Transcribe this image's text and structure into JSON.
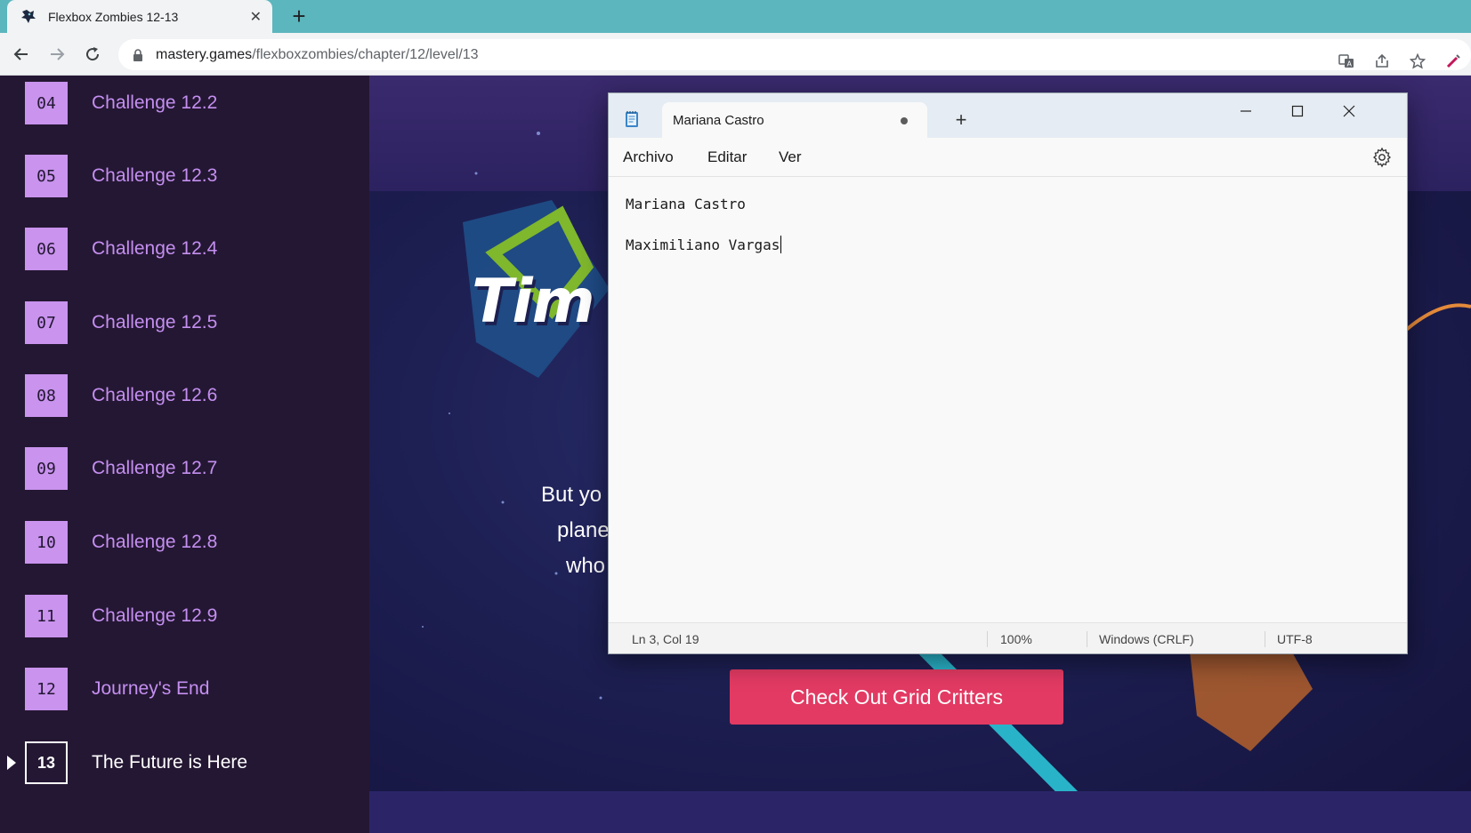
{
  "browser": {
    "tab_title": "Flexbox Zombies 12-13",
    "url_host": "mastery.games",
    "url_path": "/flexboxzombies/chapter/12/level/13",
    "icons": [
      "back-icon",
      "forward-icon",
      "reload-icon",
      "lock-icon",
      "translate-icon",
      "share-icon",
      "star-icon",
      "extension-icon"
    ]
  },
  "sidebar": {
    "levels": [
      {
        "num": "04",
        "name": "Challenge 12.2"
      },
      {
        "num": "05",
        "name": "Challenge 12.3"
      },
      {
        "num": "06",
        "name": "Challenge 12.4"
      },
      {
        "num": "07",
        "name": "Challenge 12.5"
      },
      {
        "num": "08",
        "name": "Challenge 12.6"
      },
      {
        "num": "09",
        "name": "Challenge 12.7"
      },
      {
        "num": "10",
        "name": "Challenge 12.8"
      },
      {
        "num": "11",
        "name": "Challenge 12.9"
      },
      {
        "num": "12",
        "name": "Journey's End"
      },
      {
        "num": "13",
        "name": "The Future is Here"
      }
    ],
    "current_index": 9,
    "accent": "#c993ee"
  },
  "hero": {
    "logo_partial": "Tim",
    "line1": "But yo",
    "line2": "plane",
    "line3": "who",
    "cta": "Check Out Grid Critters",
    "cta_color": "#e23a63"
  },
  "notepad": {
    "tab_title": "Mariana Castro",
    "menu": [
      "Archivo",
      "Editar",
      "Ver"
    ],
    "lines": [
      "Mariana Castro",
      "Maximiliano Vargas"
    ],
    "status": {
      "position": "Ln 3, Col 19",
      "zoom": "100%",
      "line_ending": "Windows (CRLF)",
      "encoding": "UTF-8"
    }
  }
}
